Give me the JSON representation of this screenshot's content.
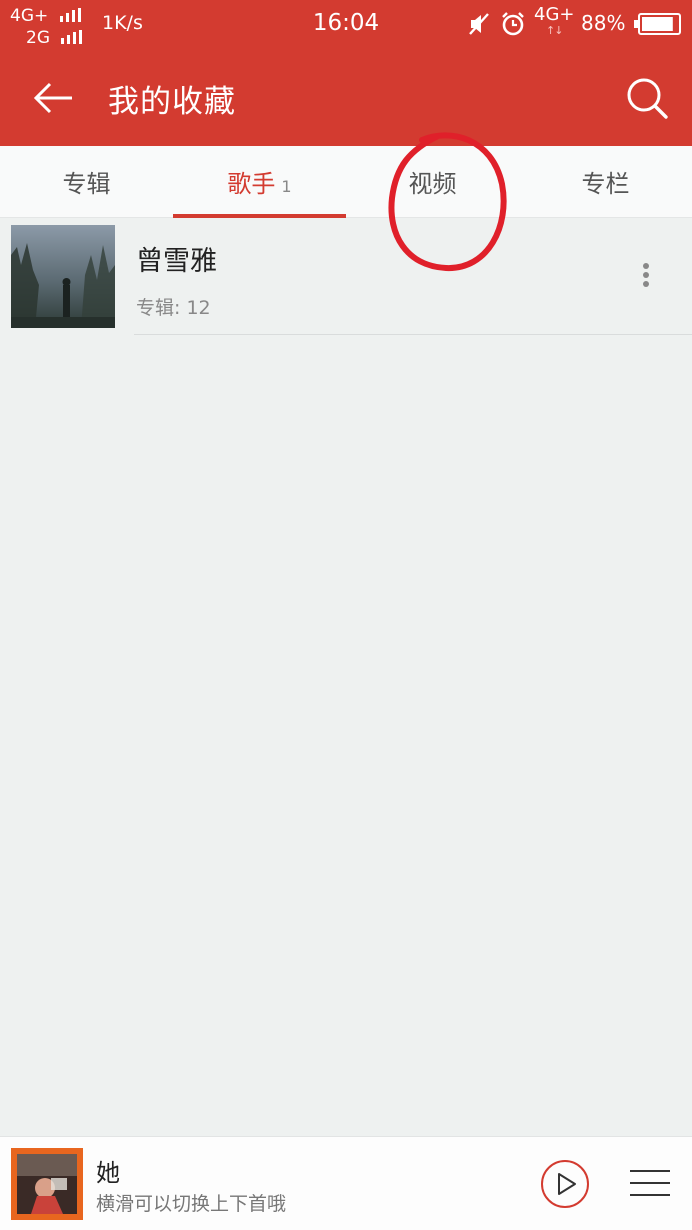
{
  "status_bar": {
    "network_1": "4G+",
    "network_2": "2G",
    "speed": "1K/s",
    "time": "16:04",
    "network_3": "4G+",
    "data_arrows": "↑↓",
    "battery_percent": "88%",
    "battery_level": 0.88,
    "icons": [
      "signal-icon",
      "mute-icon",
      "alarm-icon",
      "battery-icon"
    ]
  },
  "app_bar": {
    "title": "我的收藏",
    "back_icon": "arrow-left-icon",
    "search_icon": "search-icon"
  },
  "tabs": [
    {
      "label": "专辑",
      "count": "",
      "active": false
    },
    {
      "label": "歌手",
      "count": "1",
      "active": true
    },
    {
      "label": "视频",
      "count": "",
      "active": false
    },
    {
      "label": "专栏",
      "count": "",
      "active": false
    }
  ],
  "artists": [
    {
      "name": "曾雪雅",
      "meta": "专辑: 12",
      "more_icon": "more-vertical-icon"
    }
  ],
  "player": {
    "title": "她",
    "hint": "横滑可以切换上下首哦",
    "play_icon": "play-icon",
    "playlist_icon": "playlist-icon"
  },
  "colors": {
    "primary": "#d33b30",
    "background": "#eef1f0",
    "annotation": "#e0202a"
  }
}
